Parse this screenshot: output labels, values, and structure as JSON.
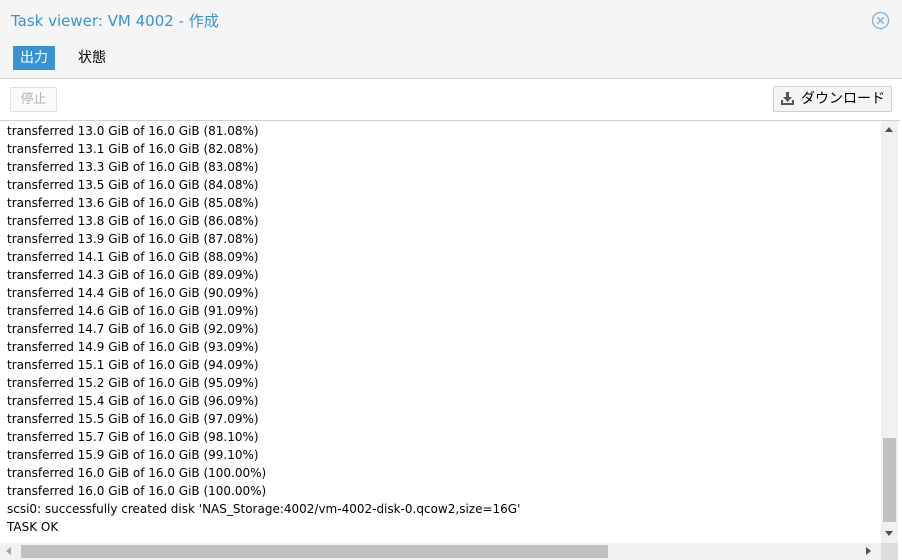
{
  "window": {
    "title": "Task viewer: VM 4002 - 作成",
    "close_icon": "close-circle-icon",
    "accent_color": "#3892d4"
  },
  "tabs": [
    {
      "label": "出力",
      "active": true
    },
    {
      "label": "状態",
      "active": false
    }
  ],
  "toolbar": {
    "stop_label": "停止",
    "stop_enabled": false,
    "download_label": "ダウンロード",
    "download_icon": "download-icon"
  },
  "log": {
    "lines": [
      "transferred 13.0 GiB of 16.0 GiB (81.08%)",
      "transferred 13.1 GiB of 16.0 GiB (82.08%)",
      "transferred 13.3 GiB of 16.0 GiB (83.08%)",
      "transferred 13.5 GiB of 16.0 GiB (84.08%)",
      "transferred 13.6 GiB of 16.0 GiB (85.08%)",
      "transferred 13.8 GiB of 16.0 GiB (86.08%)",
      "transferred 13.9 GiB of 16.0 GiB (87.08%)",
      "transferred 14.1 GiB of 16.0 GiB (88.09%)",
      "transferred 14.3 GiB of 16.0 GiB (89.09%)",
      "transferred 14.4 GiB of 16.0 GiB (90.09%)",
      "transferred 14.6 GiB of 16.0 GiB (91.09%)",
      "transferred 14.7 GiB of 16.0 GiB (92.09%)",
      "transferred 14.9 GiB of 16.0 GiB (93.09%)",
      "transferred 15.1 GiB of 16.0 GiB (94.09%)",
      "transferred 15.2 GiB of 16.0 GiB (95.09%)",
      "transferred 15.4 GiB of 16.0 GiB (96.09%)",
      "transferred 15.5 GiB of 16.0 GiB (97.09%)",
      "transferred 15.7 GiB of 16.0 GiB (98.10%)",
      "transferred 15.9 GiB of 16.0 GiB (99.10%)",
      "transferred 16.0 GiB of 16.0 GiB (100.00%)",
      "transferred 16.0 GiB of 16.0 GiB (100.00%)",
      "scsi0: successfully created disk 'NAS_Storage:4002/vm-4002-disk-0.qcow2,size=16G'",
      "TASK OK"
    ]
  }
}
